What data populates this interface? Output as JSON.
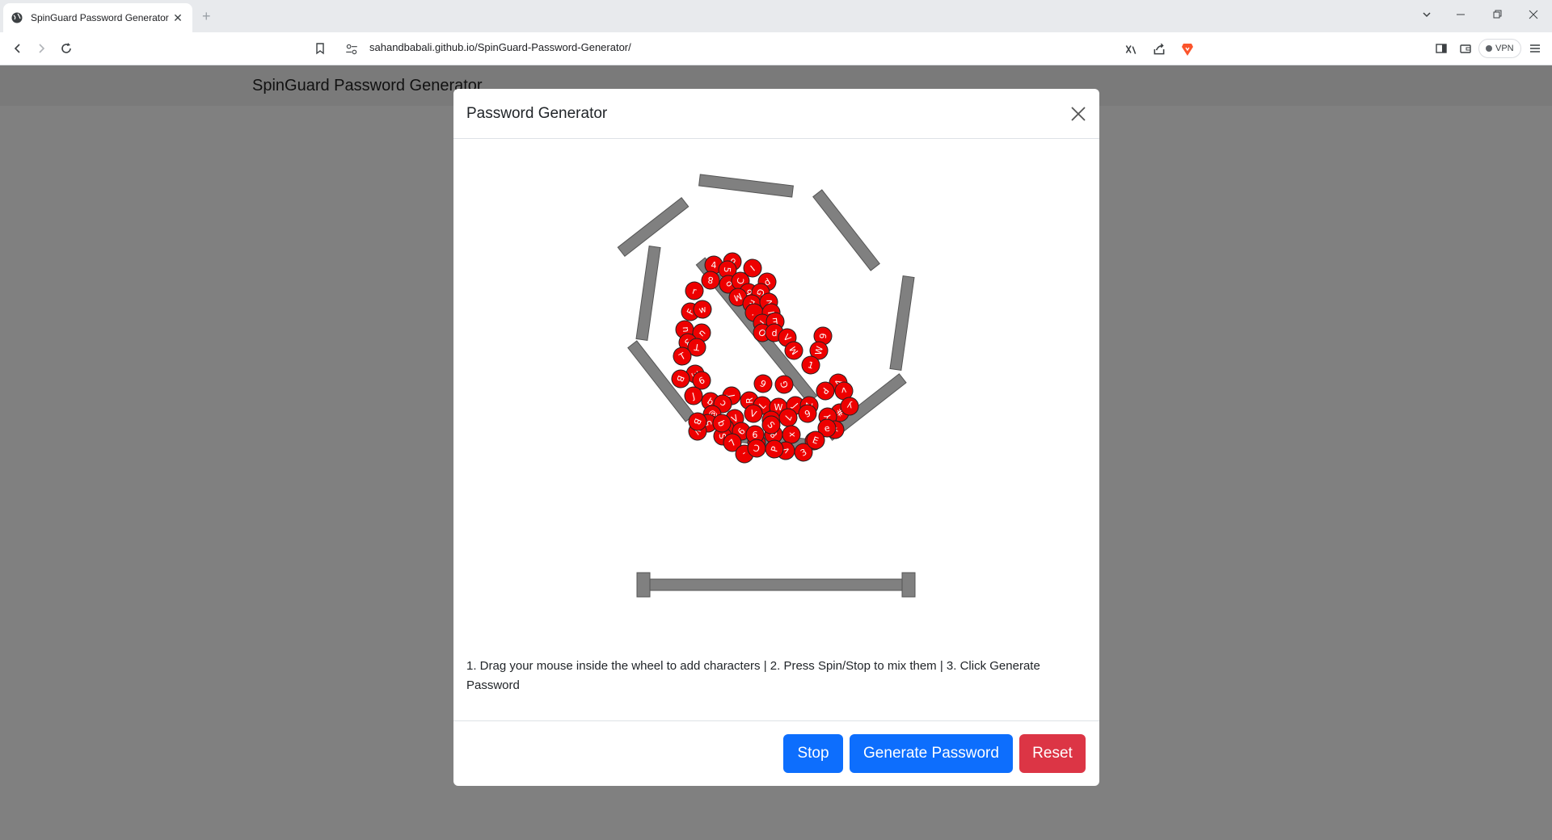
{
  "browser": {
    "tab_title": "SpinGuard Password Generator",
    "tab_close": "✕",
    "new_tab": "+",
    "url": "sahandbabali.github.io/SpinGuard-Password-Generator/",
    "vpn_label": "VPN"
  },
  "page": {
    "title": "SpinGuard Password Generator"
  },
  "modal": {
    "title": "Password Generator",
    "instructions": "1. Drag your mouse inside the wheel to add characters | 2. Press Spin/Stop to mix them | 3. Click Generate Password",
    "buttons": {
      "stop": "Stop",
      "generate": "Generate Password",
      "reset": "Reset"
    }
  },
  "balls": [
    {
      "c": "4"
    },
    {
      "c": "9"
    },
    {
      "c": "5"
    },
    {
      "c": "I"
    },
    {
      "c": "8"
    },
    {
      "c": "o"
    },
    {
      "c": "C"
    },
    {
      "c": "d"
    },
    {
      "c": "r"
    },
    {
      "c": "9"
    },
    {
      "c": "G"
    },
    {
      "c": "M"
    },
    {
      "c": "E"
    },
    {
      "c": "v"
    },
    {
      "c": "F"
    },
    {
      "c": "w"
    },
    {
      "c": "."
    },
    {
      "c": "I"
    },
    {
      "c": "r"
    },
    {
      "c": "E"
    },
    {
      "c": "O"
    },
    {
      "c": "u"
    },
    {
      "c": "n"
    },
    {
      "c": "d"
    },
    {
      "c": "V"
    },
    {
      "c": "6"
    },
    {
      "c": "3"
    },
    {
      "c": "T"
    },
    {
      "c": "M"
    },
    {
      "c": "W"
    },
    {
      "c": "T"
    },
    {
      "c": "1"
    },
    {
      "c": "3"
    },
    {
      "c": "B"
    },
    {
      "c": "9"
    },
    {
      "c": "6"
    },
    {
      "c": "G"
    },
    {
      "c": "A"
    },
    {
      "c": "J"
    },
    {
      "c": "b"
    },
    {
      "c": "J"
    },
    {
      "c": "P"
    },
    {
      "c": "v"
    },
    {
      "c": "c"
    },
    {
      "c": "R"
    },
    {
      "c": "L"
    },
    {
      "c": "W"
    },
    {
      "c": "J"
    },
    {
      "c": "Z"
    },
    {
      "c": "#"
    },
    {
      "c": "y"
    },
    {
      "c": "Y"
    },
    {
      "c": "@"
    },
    {
      "c": "V"
    },
    {
      "c": "V"
    },
    {
      "c": "S"
    },
    {
      "c": "7"
    },
    {
      "c": "6"
    },
    {
      "c": "'"
    },
    {
      "c": "5"
    },
    {
      "c": "+"
    },
    {
      "c": "e"
    },
    {
      "c": "<"
    },
    {
      "c": "S"
    },
    {
      "c": "9"
    },
    {
      "c": "L"
    },
    {
      "c": "8"
    },
    {
      "c": "x"
    },
    {
      "c": "7"
    },
    {
      "c": "6"
    },
    {
      "c": "S"
    },
    {
      "c": "#"
    },
    {
      "c": "-"
    },
    {
      "c": "C"
    },
    {
      "c": "v"
    },
    {
      "c": "P"
    },
    {
      "c": "3"
    },
    {
      "c": "E"
    },
    {
      "c": "b"
    },
    {
      "c": "B"
    }
  ]
}
